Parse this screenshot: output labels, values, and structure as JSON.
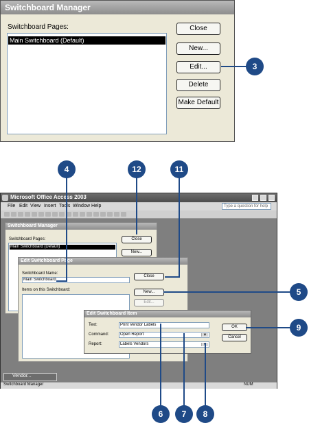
{
  "top_dialog": {
    "title": "Switchboard Manager",
    "pages_label": "Switchboard Pages:",
    "selected_page": "Main Switchboard (Default)",
    "buttons": {
      "close": "Close",
      "new": "New...",
      "edit": "Edit...",
      "delete": "Delete",
      "make_default": "Make Default"
    }
  },
  "access_window": {
    "title": "Microsoft Office Access 2003",
    "menu": [
      "File",
      "Edit",
      "View",
      "Insert",
      "Tools",
      "Window",
      "Help"
    ],
    "help_box": "Type a question for help",
    "status_left": "Switchboard Manager",
    "status_right": "NUM",
    "minimized_label": "Vendor..."
  },
  "mini_manager": {
    "title": "Switchboard Manager",
    "pages_label": "Switchboard Pages:",
    "selected_page": "Main Switchboard (Default)",
    "close": "Close",
    "new": "New..."
  },
  "edit_page": {
    "title": "Edit Switchboard Page",
    "name_label": "Switchboard Name:",
    "name_value": "Main Switchboard",
    "items_label": "Items on this Switchboard:",
    "close": "Close",
    "new": "New...",
    "edit": "Edit..."
  },
  "edit_item": {
    "title": "Edit Switchboard Item",
    "text_label": "Text:",
    "text_value": "Print Vendor Labels",
    "command_label": "Command:",
    "command_value": "Open Report",
    "report_label": "Report:",
    "report_value": "Labels Vendors",
    "ok": "OK",
    "cancel": "Cancel"
  },
  "callouts": [
    "3",
    "4",
    "12",
    "11",
    "5",
    "9",
    "6",
    "7",
    "8"
  ],
  "colors": {
    "callout": "#1f4a87",
    "dialog_bg": "#ece9d8",
    "app_bg": "#7f7f7f"
  }
}
